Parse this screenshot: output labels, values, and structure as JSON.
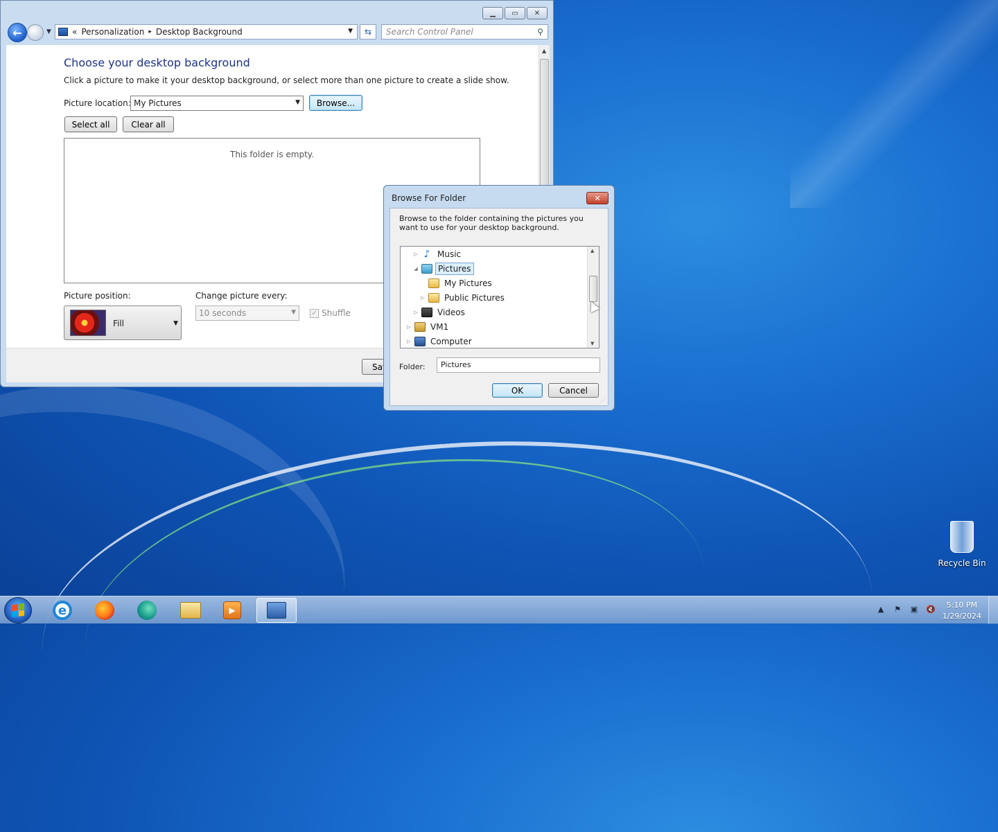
{
  "window": {
    "controls": {
      "minimize_icon": "minimize-icon",
      "maximize_icon": "maximize-icon",
      "close_icon": "close-icon"
    },
    "address": {
      "chevrons": "«",
      "crumbs": [
        "Personalization",
        "Desktop Background"
      ],
      "separator": "▸"
    },
    "search": {
      "placeholder": "Search Control Panel"
    },
    "title": "Choose your desktop background",
    "description": "Click a picture to make it your desktop background, or select more than one picture to create a slide show.",
    "picture_location": {
      "label": "Picture location:",
      "value": "My Pictures",
      "browse_label": "Browse..."
    },
    "select_all_label": "Select all",
    "clear_all_label": "Clear all",
    "empty_message": "This folder is empty.",
    "picture_position": {
      "label": "Picture position:",
      "value": "Fill"
    },
    "change_every": {
      "label": "Change picture every:",
      "value": "10 seconds"
    },
    "shuffle": {
      "label": "Shuffle",
      "checked": true
    },
    "save_label": "Sav"
  },
  "dialog": {
    "title": "Browse For Folder",
    "close_icon": "close-icon",
    "description": "Browse to the folder containing the pictures you want to use for your desktop background.",
    "tree": [
      {
        "label": "Music",
        "expander": "▷",
        "icon": "music-icon"
      },
      {
        "label": "Pictures",
        "expander": "◢",
        "icon": "pictures-library-icon",
        "selected": true
      },
      {
        "label": "My Pictures",
        "expander": "",
        "icon": "folder-icon"
      },
      {
        "label": "Public Pictures",
        "expander": "▷",
        "icon": "folder-icon"
      },
      {
        "label": "Videos",
        "expander": "▷",
        "icon": "videos-icon"
      },
      {
        "label": "VM1",
        "expander": "▷",
        "icon": "user-folder-icon"
      },
      {
        "label": "Computer",
        "expander": "▷",
        "icon": "computer-icon"
      }
    ],
    "folder_label": "Folder:",
    "folder_value": "Pictures",
    "ok_label": "OK",
    "cancel_label": "Cancel"
  },
  "desktop": {
    "recycle_bin_label": "Recycle Bin"
  },
  "taskbar": {
    "apps": [
      "internet-explorer-icon",
      "firefox-icon",
      "edge-icon",
      "file-explorer-icon",
      "media-player-icon",
      "control-panel-icon"
    ],
    "tray": [
      "show-hidden-icons-icon",
      "action-center-flag-icon",
      "network-icon",
      "volume-muted-icon"
    ],
    "time": "5:10 PM",
    "date": "1/29/2024"
  }
}
